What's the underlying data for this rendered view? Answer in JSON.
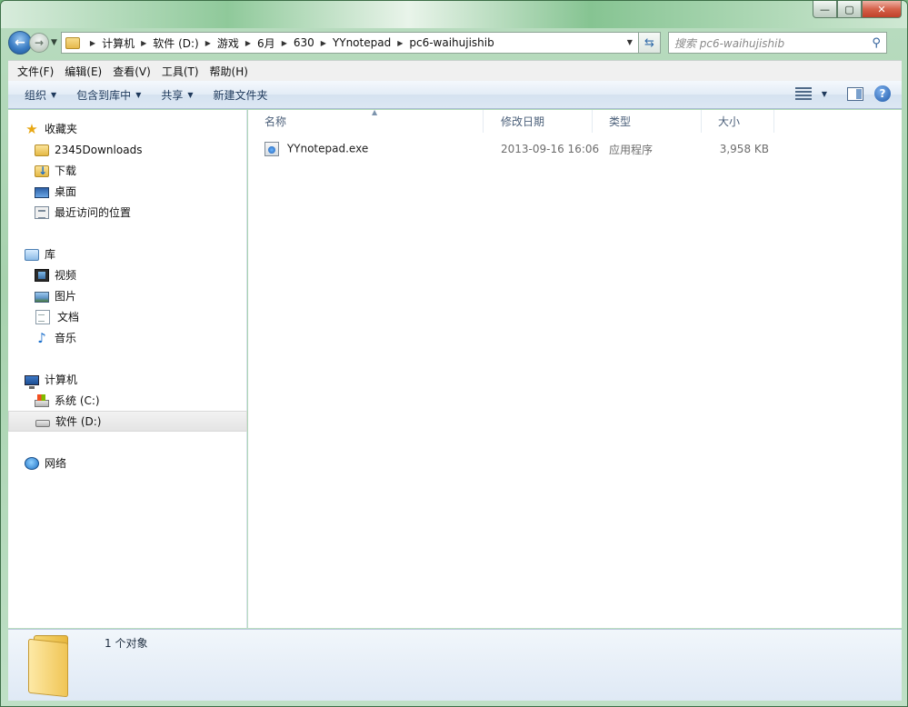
{
  "window": {
    "caption": {
      "minimize": "—",
      "maximize": "▢",
      "close": "✕"
    }
  },
  "address": {
    "crumbs": [
      "计算机",
      "软件 (D:)",
      "游戏",
      "6月",
      "630",
      "YYnotepad",
      "pc6-waihujishib"
    ],
    "search_placeholder": "搜索 pc6-waihujishib"
  },
  "menu": {
    "items": [
      "文件(F)",
      "编辑(E)",
      "查看(V)",
      "工具(T)",
      "帮助(H)"
    ]
  },
  "toolbar": {
    "organize": "组织",
    "include_in_library": "包含到库中",
    "share": "共享",
    "new_folder": "新建文件夹"
  },
  "nav": {
    "favorites": {
      "label": "收藏夹",
      "items": [
        "2345Downloads",
        "下载",
        "桌面",
        "最近访问的位置"
      ]
    },
    "libraries": {
      "label": "库",
      "items": [
        "视频",
        "图片",
        "文档",
        "音乐"
      ]
    },
    "computer": {
      "label": "计算机",
      "items": [
        "系统 (C:)",
        "软件 (D:)"
      ],
      "selected": "软件 (D:)"
    },
    "network": {
      "label": "网络"
    }
  },
  "columns": [
    "名称",
    "修改日期",
    "类型",
    "大小"
  ],
  "files": [
    {
      "name": "YYnotepad.exe",
      "modified": "2013-09-16 16:06",
      "type": "应用程序",
      "size": "3,958 KB"
    }
  ],
  "details": {
    "count": "1 个对象"
  }
}
